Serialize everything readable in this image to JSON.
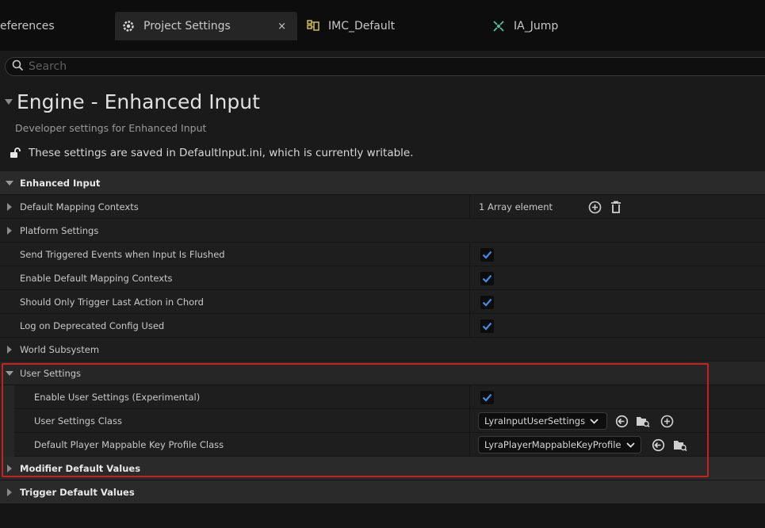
{
  "tabs": [
    {
      "label": "eferences"
    },
    {
      "label": "Project Settings",
      "close": "×"
    },
    {
      "label": "IMC_Default"
    },
    {
      "label": "IA_Jump"
    }
  ],
  "search": {
    "placeholder": "Search"
  },
  "header": {
    "title": "Engine - Enhanced Input",
    "subtitle": "Developer settings for Enhanced Input",
    "notice": "These settings are saved in DefaultInput.ini, which is currently writable."
  },
  "grid": {
    "category_enhanced_input": "Enhanced Input",
    "default_mapping_contexts": {
      "label": "Default Mapping Contexts",
      "value": "1 Array element"
    },
    "platform_settings": "Platform Settings",
    "send_triggered_events": {
      "label": "Send Triggered Events when Input Is Flushed",
      "checked": true
    },
    "enable_default_mapping_contexts": {
      "label": "Enable Default Mapping Contexts",
      "checked": true
    },
    "should_only_trigger_last_action": {
      "label": "Should Only Trigger Last Action in Chord",
      "checked": true
    },
    "log_on_deprecated": {
      "label": "Log on Deprecated Config Used",
      "checked": true
    },
    "world_subsystem": "World Subsystem",
    "user_settings": "User Settings",
    "enable_user_settings": {
      "label": "Enable User Settings (Experimental)",
      "checked": true
    },
    "user_settings_class": {
      "label": "User Settings Class",
      "value": "LyraInputUserSettings"
    },
    "default_player_key_profile": {
      "label": "Default Player Mappable Key Profile Class",
      "value": "LyraPlayerMappableKeyProfile"
    },
    "modifier_default_values": "Modifier Default Values",
    "trigger_default_values": "Trigger Default Values"
  },
  "colors": {
    "accent_checkbox": "#3d8ee8",
    "highlight_border": "#c8201e",
    "imc_icon": "#cfc044",
    "ia_icon": "#4fc49a"
  }
}
